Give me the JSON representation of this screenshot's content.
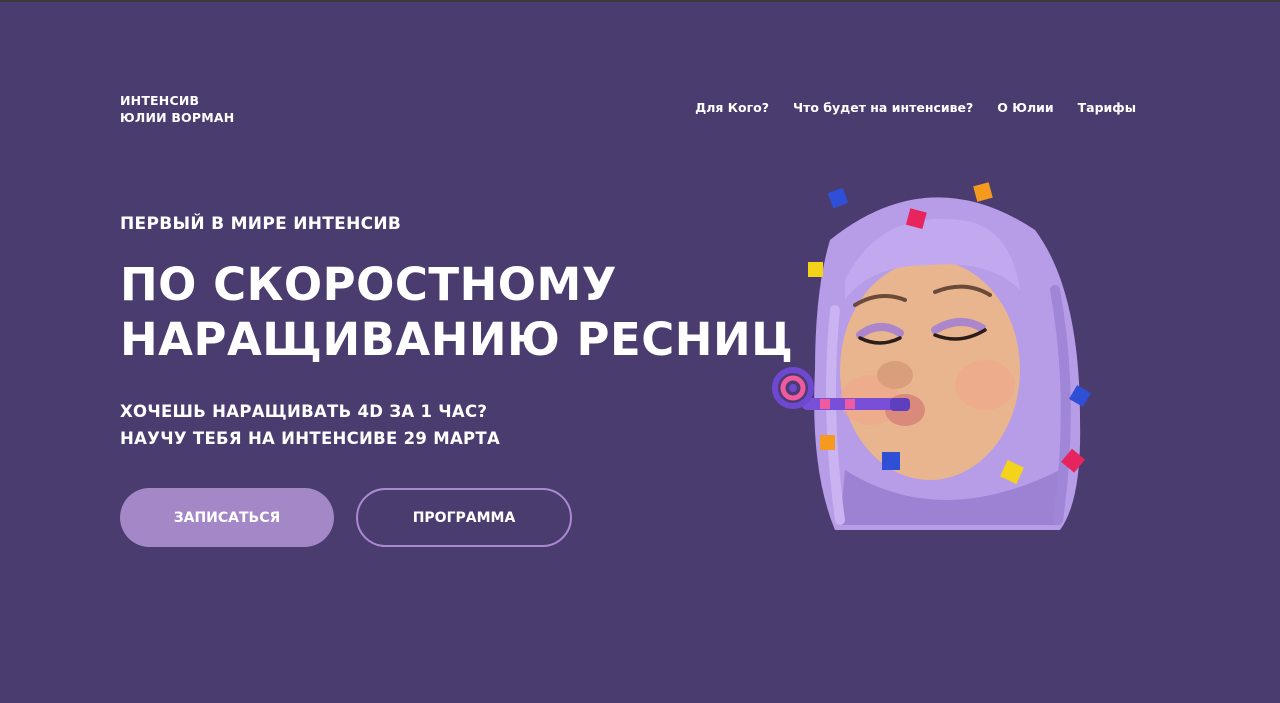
{
  "logo": {
    "line1": "ИНТЕНСИВ",
    "line2": "ЮЛИИ ВОРМАН"
  },
  "nav": {
    "items": [
      {
        "label": "Для Кого?"
      },
      {
        "label": "Что будет на интенсиве?"
      },
      {
        "label": "О Юлии"
      },
      {
        "label": "Тарифы"
      }
    ]
  },
  "hero": {
    "kicker": "ПЕРВЫЙ В МИРЕ ИНТЕНСИВ",
    "title_line1": "ПО СКОРОСТНОМУ",
    "title_line2": "НАРАЩИВАНИЮ РЕСНИЦ",
    "sub_line1": "ХОЧЕШЬ НАРАЩИВАТЬ 4D ЗА 1 ЧАС?",
    "sub_line2": "НАУЧУ ТЕБЯ НА ИНТЕНСИВЕ 29 МАРТА",
    "primary_button": "ЗАПИСАТЬСЯ",
    "secondary_button": "ПРОГРАММА"
  },
  "illustration": {
    "icon": "memoji-party-girl-icon"
  },
  "colors": {
    "background": "#4b3c70",
    "primary_button": "#a387c6",
    "secondary_border": "#a98ad0",
    "hair": "#b79ce8",
    "skin": "#e8b58f"
  }
}
